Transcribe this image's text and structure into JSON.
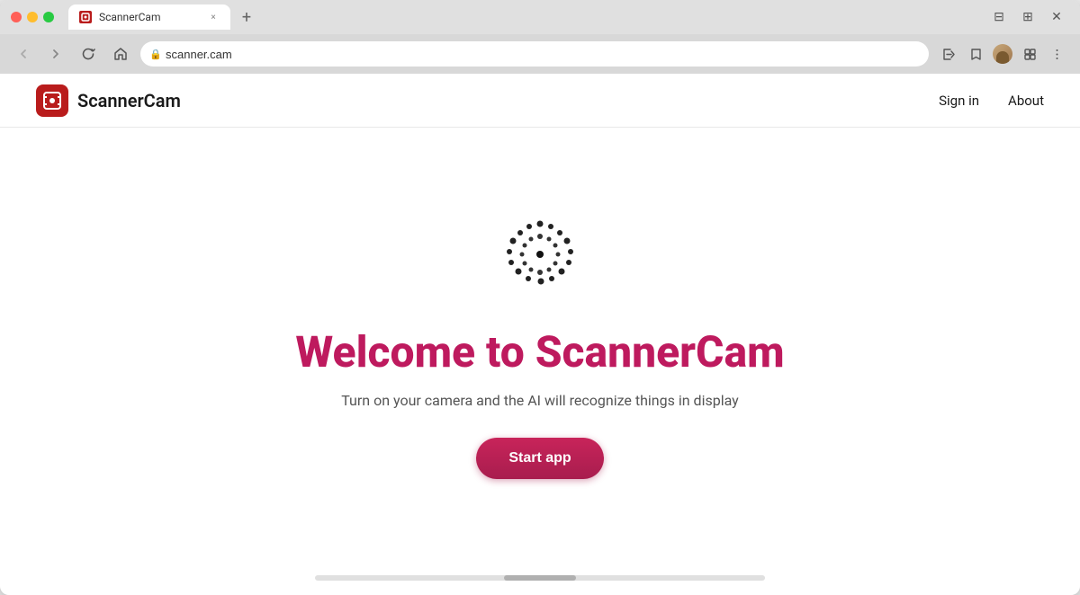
{
  "browser": {
    "tab_title": "ScannerCam",
    "tab_close_label": "×",
    "new_tab_label": "+",
    "address": "scanner.cam",
    "nav": {
      "back_label": "‹",
      "forward_label": "›",
      "reload_label": "↻",
      "home_label": "⌂"
    }
  },
  "site": {
    "name": "ScannerCam",
    "nav_links": [
      {
        "label": "Sign in",
        "id": "sign-in"
      },
      {
        "label": "About",
        "id": "about"
      }
    ]
  },
  "hero": {
    "title": "Welcome to ScannerCam",
    "subtitle": "Turn on your camera and the AI will recognize things in display",
    "start_button": "Start app"
  }
}
